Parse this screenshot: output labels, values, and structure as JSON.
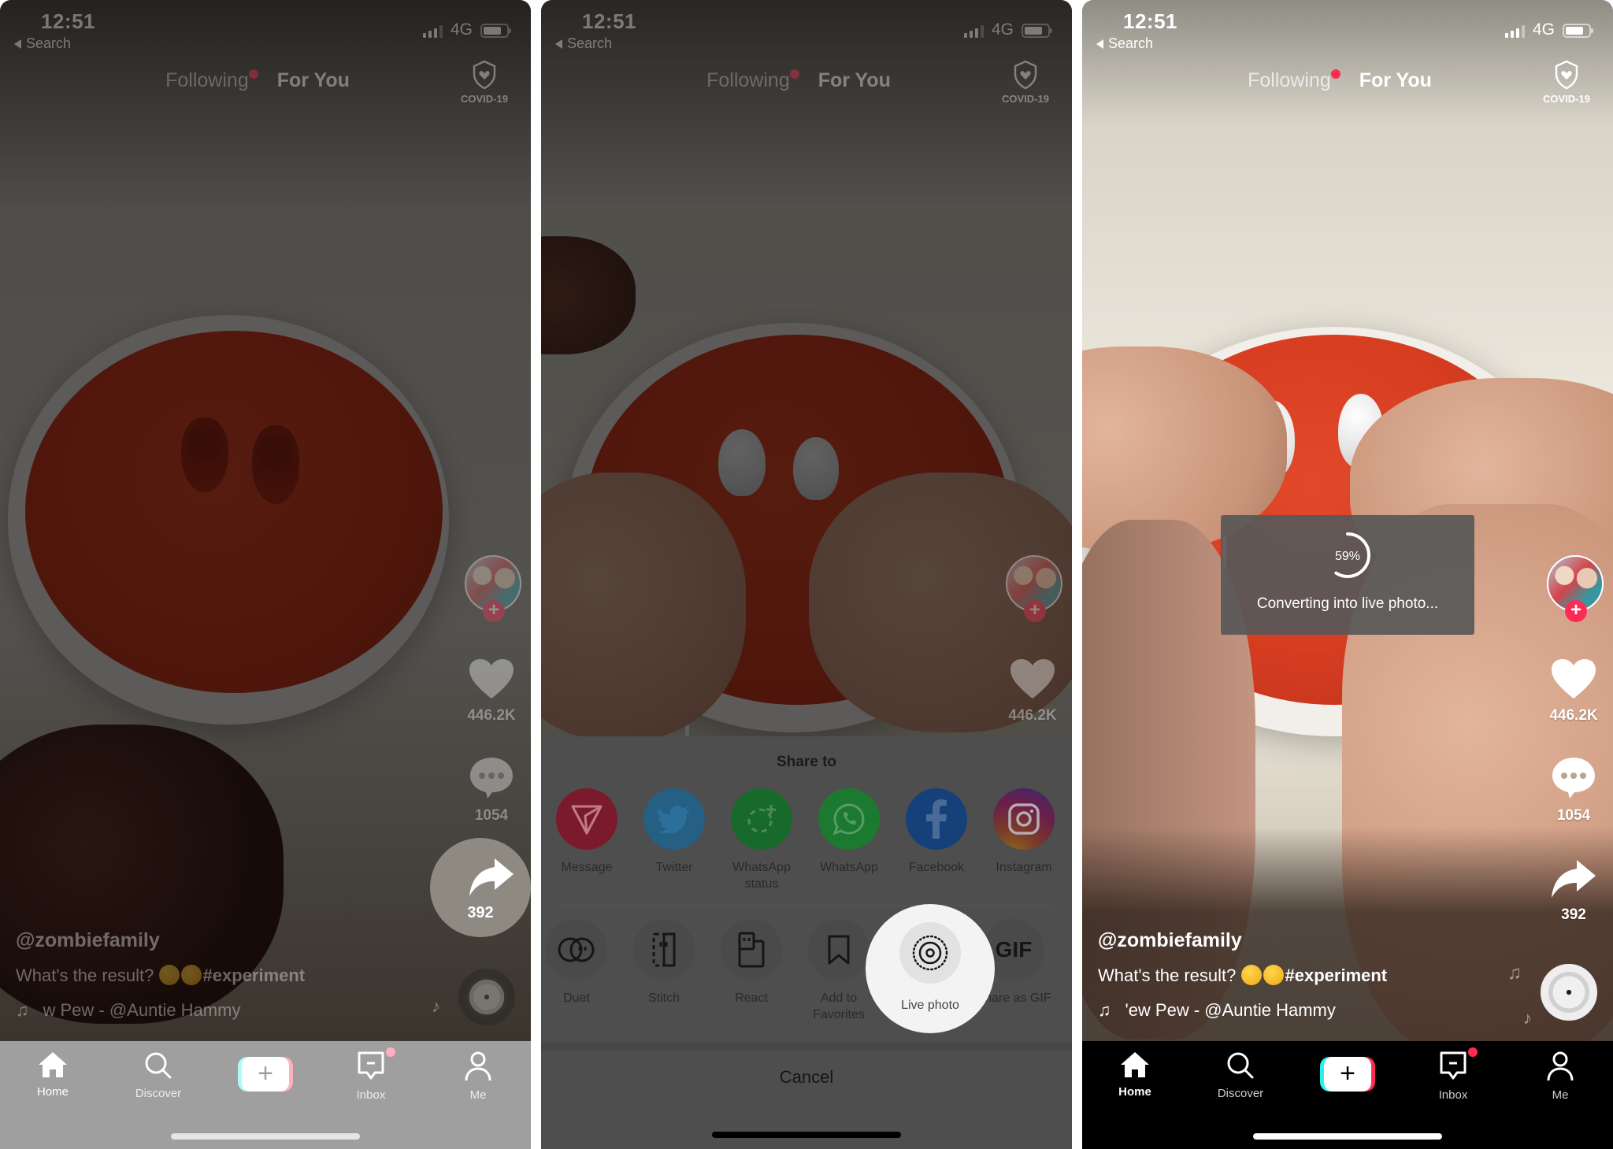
{
  "status_bar": {
    "time": "12:51",
    "back_label": "Search",
    "network": "4G"
  },
  "feed_tabs": {
    "following": "Following",
    "for_you": "For You"
  },
  "covid_label": "COVID-19",
  "video": {
    "username": "@zombiefamily",
    "caption_text": "What's the result?",
    "caption_hashtag": "#experiment",
    "music_p1": "w Pew - @Auntie Hammy",
    "music_p3": "'ew Pew - @Auntie Hammy",
    "likes": "446.2K",
    "comments": "1054",
    "shares": "392"
  },
  "nav": {
    "home": "Home",
    "discover": "Discover",
    "create": "+",
    "inbox": "Inbox",
    "me": "Me"
  },
  "share_sheet": {
    "title": "Share to",
    "targets": [
      {
        "label": "Message",
        "icon": "message-icon",
        "color": "#e6284f"
      },
      {
        "label": "Twitter",
        "icon": "twitter-icon",
        "color": "#1da1f2"
      },
      {
        "label": "WhatsApp status",
        "icon": "whatsapp-status-icon",
        "color": "#1faa3f"
      },
      {
        "label": "WhatsApp",
        "icon": "whatsapp-icon",
        "color": "#25c144"
      },
      {
        "label": "Facebook",
        "icon": "facebook-icon",
        "color": "#1877f2"
      },
      {
        "label": "Instagram",
        "icon": "instagram-icon",
        "color": "#c13584"
      }
    ],
    "actions": [
      {
        "label": "Duet",
        "icon": "duet-icon"
      },
      {
        "label": "Stitch",
        "icon": "stitch-icon"
      },
      {
        "label": "React",
        "icon": "react-icon"
      },
      {
        "label": "Add to Favorites",
        "icon": "bookmark-icon"
      },
      {
        "label": "Live photo",
        "icon": "live-photo-icon"
      },
      {
        "label": "Share as GIF",
        "icon": "gif-icon",
        "glyph": "GIF"
      }
    ],
    "cancel": "Cancel"
  },
  "conversion": {
    "progress_percent": 59,
    "progress_label": "59%",
    "message": "Converting into live photo..."
  },
  "colors": {
    "accent": "#fe2c55",
    "cyan": "#25f4ee"
  }
}
